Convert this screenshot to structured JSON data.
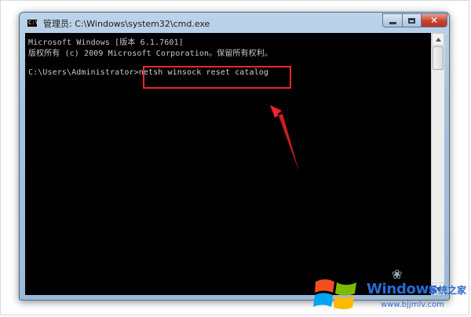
{
  "window": {
    "title": "管理员: C:\\Windows\\system32\\cmd.exe",
    "icon": "C:\\",
    "minimize_icon": "minimize-icon",
    "maximize_icon": "maximize-icon",
    "close_label": "✕"
  },
  "console": {
    "lines": [
      "Microsoft Windows [版本 6.1.7601]",
      "版权所有 (c) 2009 Microsoft Corporation。保留所有权利。",
      "C:\\Users\\Administrator>"
    ],
    "command": "netsh winsock reset catalog"
  },
  "annotation": {
    "highlight_color": "#e8262a",
    "arrow_color": "#e8262a"
  },
  "watermark": {
    "brand": "Windows",
    "brand_cn": "系统之家",
    "url": "www.bjjmlv.com",
    "logo_colors": [
      "#f25022",
      "#7fba00",
      "#00a4ef",
      "#ffb900"
    ]
  }
}
